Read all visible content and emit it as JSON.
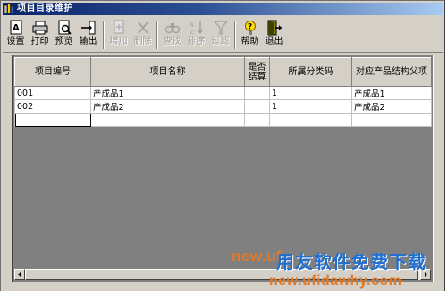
{
  "window": {
    "title": "项目目录维护"
  },
  "toolbar": {
    "buttons": [
      {
        "label": "设置",
        "icon": "settings-icon",
        "enabled": true
      },
      {
        "label": "打印",
        "icon": "printer-icon",
        "enabled": true
      },
      {
        "label": "预览",
        "icon": "preview-icon",
        "enabled": true
      },
      {
        "label": "输出",
        "icon": "export-icon",
        "enabled": true
      },
      {
        "label": "增加",
        "icon": "add-icon",
        "enabled": false
      },
      {
        "label": "删除",
        "icon": "delete-icon",
        "enabled": false
      },
      {
        "label": "查找",
        "icon": "find-icon",
        "enabled": false
      },
      {
        "label": "排序",
        "icon": "sort-icon",
        "enabled": false
      },
      {
        "label": "过滤",
        "icon": "filter-icon",
        "enabled": false
      },
      {
        "label": "帮助",
        "icon": "help-icon",
        "enabled": true
      },
      {
        "label": "退出",
        "icon": "exit-icon",
        "enabled": true
      }
    ]
  },
  "grid": {
    "columns": [
      "项目编号",
      "项目名称",
      "是否结算",
      "所属分类码",
      "对应产品结构父项"
    ],
    "rows": [
      [
        "001",
        "产成品1",
        "",
        "1",
        "产成品1"
      ],
      [
        "002",
        "产成品2",
        "",
        "1",
        "产成品2"
      ],
      [
        "",
        "",
        "",
        "",
        ""
      ]
    ]
  },
  "watermark": {
    "prefix": "new.uf",
    "brand": "用友软件免费下载",
    "url": "new.ufidawhy.com"
  },
  "colors": {
    "titlebar_start": "#0a246a",
    "titlebar_end": "#a6caf0",
    "watermark_orange": "#e07a2a",
    "watermark_blue": "#1f6fd0"
  }
}
